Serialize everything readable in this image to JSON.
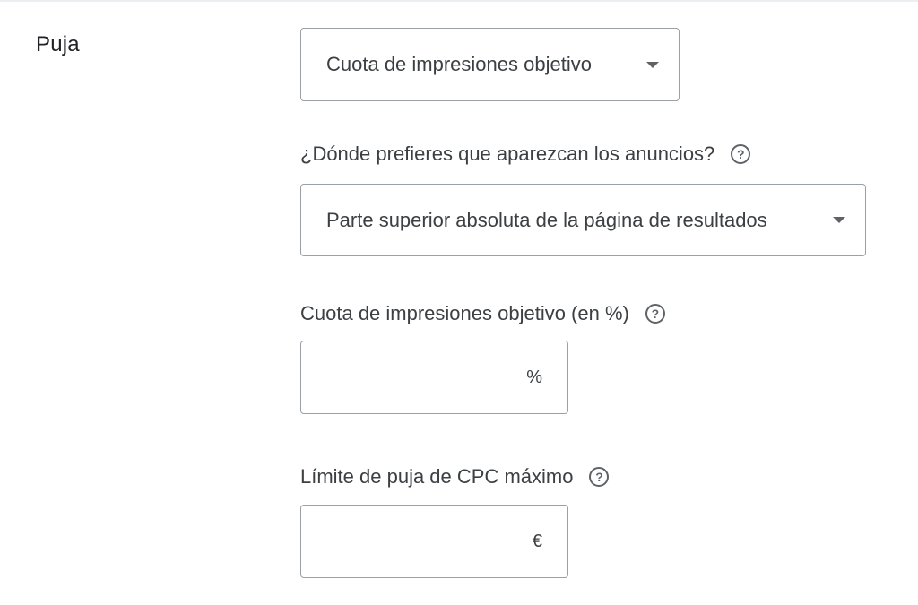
{
  "section": {
    "title": "Puja"
  },
  "bid_strategy": {
    "selected": "Cuota de impresiones objetivo"
  },
  "placement": {
    "label": "¿Dónde prefieres que aparezcan los anuncios?",
    "selected": "Parte superior absoluta de la página de resultados"
  },
  "impression_share": {
    "label": "Cuota de impresiones objetivo (en %)",
    "value": "",
    "suffix": "%"
  },
  "max_cpc": {
    "label": "Límite de puja de CPC máximo",
    "value": "",
    "suffix": "€"
  },
  "icons": {
    "help": "?"
  },
  "colors": {
    "text": "#3c4043",
    "title": "#202124",
    "border": "#9aa0a6",
    "icon": "#5f6368"
  }
}
